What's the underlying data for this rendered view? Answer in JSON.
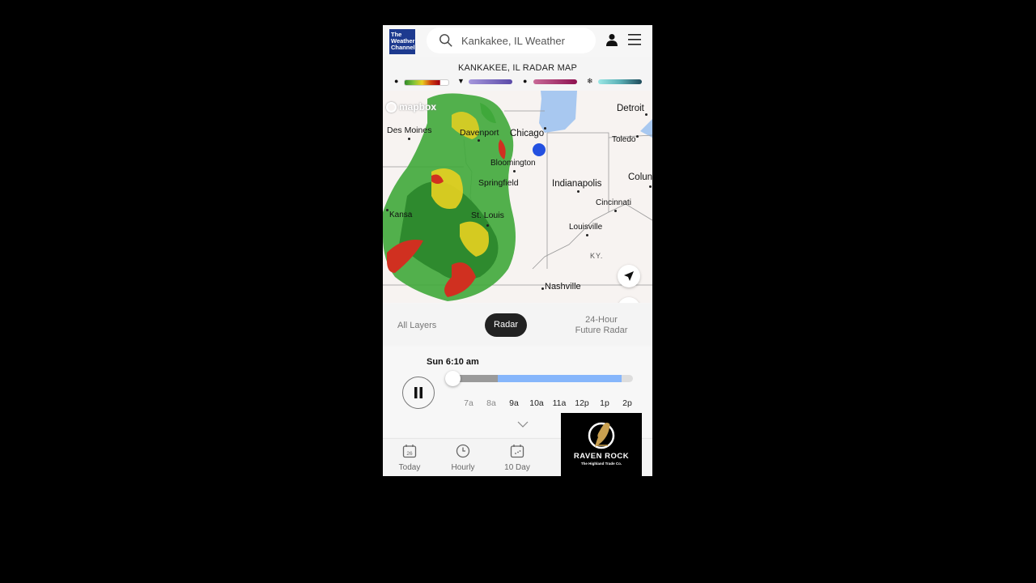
{
  "header": {
    "logo_lines": [
      "The",
      "Weather",
      "Channel"
    ],
    "search_text": "Kankakee, IL Weather",
    "search_icon": "search-icon",
    "user_icon": "user-icon",
    "menu_icon": "hamburger-menu-icon"
  },
  "radar": {
    "title": "KANKAKEE, IL RADAR MAP",
    "legend": [
      {
        "type": "rain",
        "icon": "raindrop-icon",
        "glyph": "●",
        "colors": [
          "#3a9a2a",
          "#e8d020",
          "#c01010",
          "#ffffff"
        ]
      },
      {
        "type": "mix",
        "icon": "ice-icon",
        "glyph": "▼",
        "colors": [
          "#9b8fd8",
          "#5a4aa8"
        ]
      },
      {
        "type": "freezing",
        "icon": "freezing-drop-icon",
        "glyph": "●",
        "colors": [
          "#c06090",
          "#901450"
        ]
      },
      {
        "type": "snow",
        "icon": "snowflake-icon",
        "glyph": "❄",
        "colors": [
          "#8fe0e0",
          "#1e4a5a"
        ]
      }
    ]
  },
  "map": {
    "attribution": "mapbox",
    "cities": [
      {
        "name": "Des Moines"
      },
      {
        "name": "Davenport"
      },
      {
        "name": "Chicago"
      },
      {
        "name": "Detroit"
      },
      {
        "name": "Toledo"
      },
      {
        "name": "Bloomington"
      },
      {
        "name": "Springfield"
      },
      {
        "name": "Indianapolis"
      },
      {
        "name": "Colun"
      },
      {
        "name": "Cincinnati"
      },
      {
        "name": "Kansa"
      },
      {
        "name": "St. Louis"
      },
      {
        "name": "Louisville"
      },
      {
        "name": "KY."
      },
      {
        "name": "Nashville"
      }
    ],
    "locate_button_icon": "navigation-arrow-icon",
    "fullscreen_button_icon": "fullscreen-icon"
  },
  "tabs": {
    "all_layers": "All Layers",
    "radar": "Radar",
    "future_line1": "24-Hour",
    "future_line2": "Future Radar",
    "active": "Radar"
  },
  "player": {
    "time": "Sun 6:10 am",
    "state": "playing",
    "progress_fraction": 0.0,
    "past_fraction": 0.27,
    "loaded_fraction": 0.94,
    "ticks": [
      "7a",
      "8a",
      "9a",
      "10a",
      "11a",
      "12p",
      "1p",
      "2p"
    ]
  },
  "bottom_nav": [
    {
      "label": "Today",
      "icon": "calendar-day-icon",
      "badge": "26"
    },
    {
      "label": "Hourly",
      "icon": "clock-icon"
    },
    {
      "label": "10 Day",
      "icon": "calendar-icon"
    }
  ],
  "ad": {
    "title": "RAVEN ROCK",
    "subtitle": "The Highland Trade Co."
  }
}
